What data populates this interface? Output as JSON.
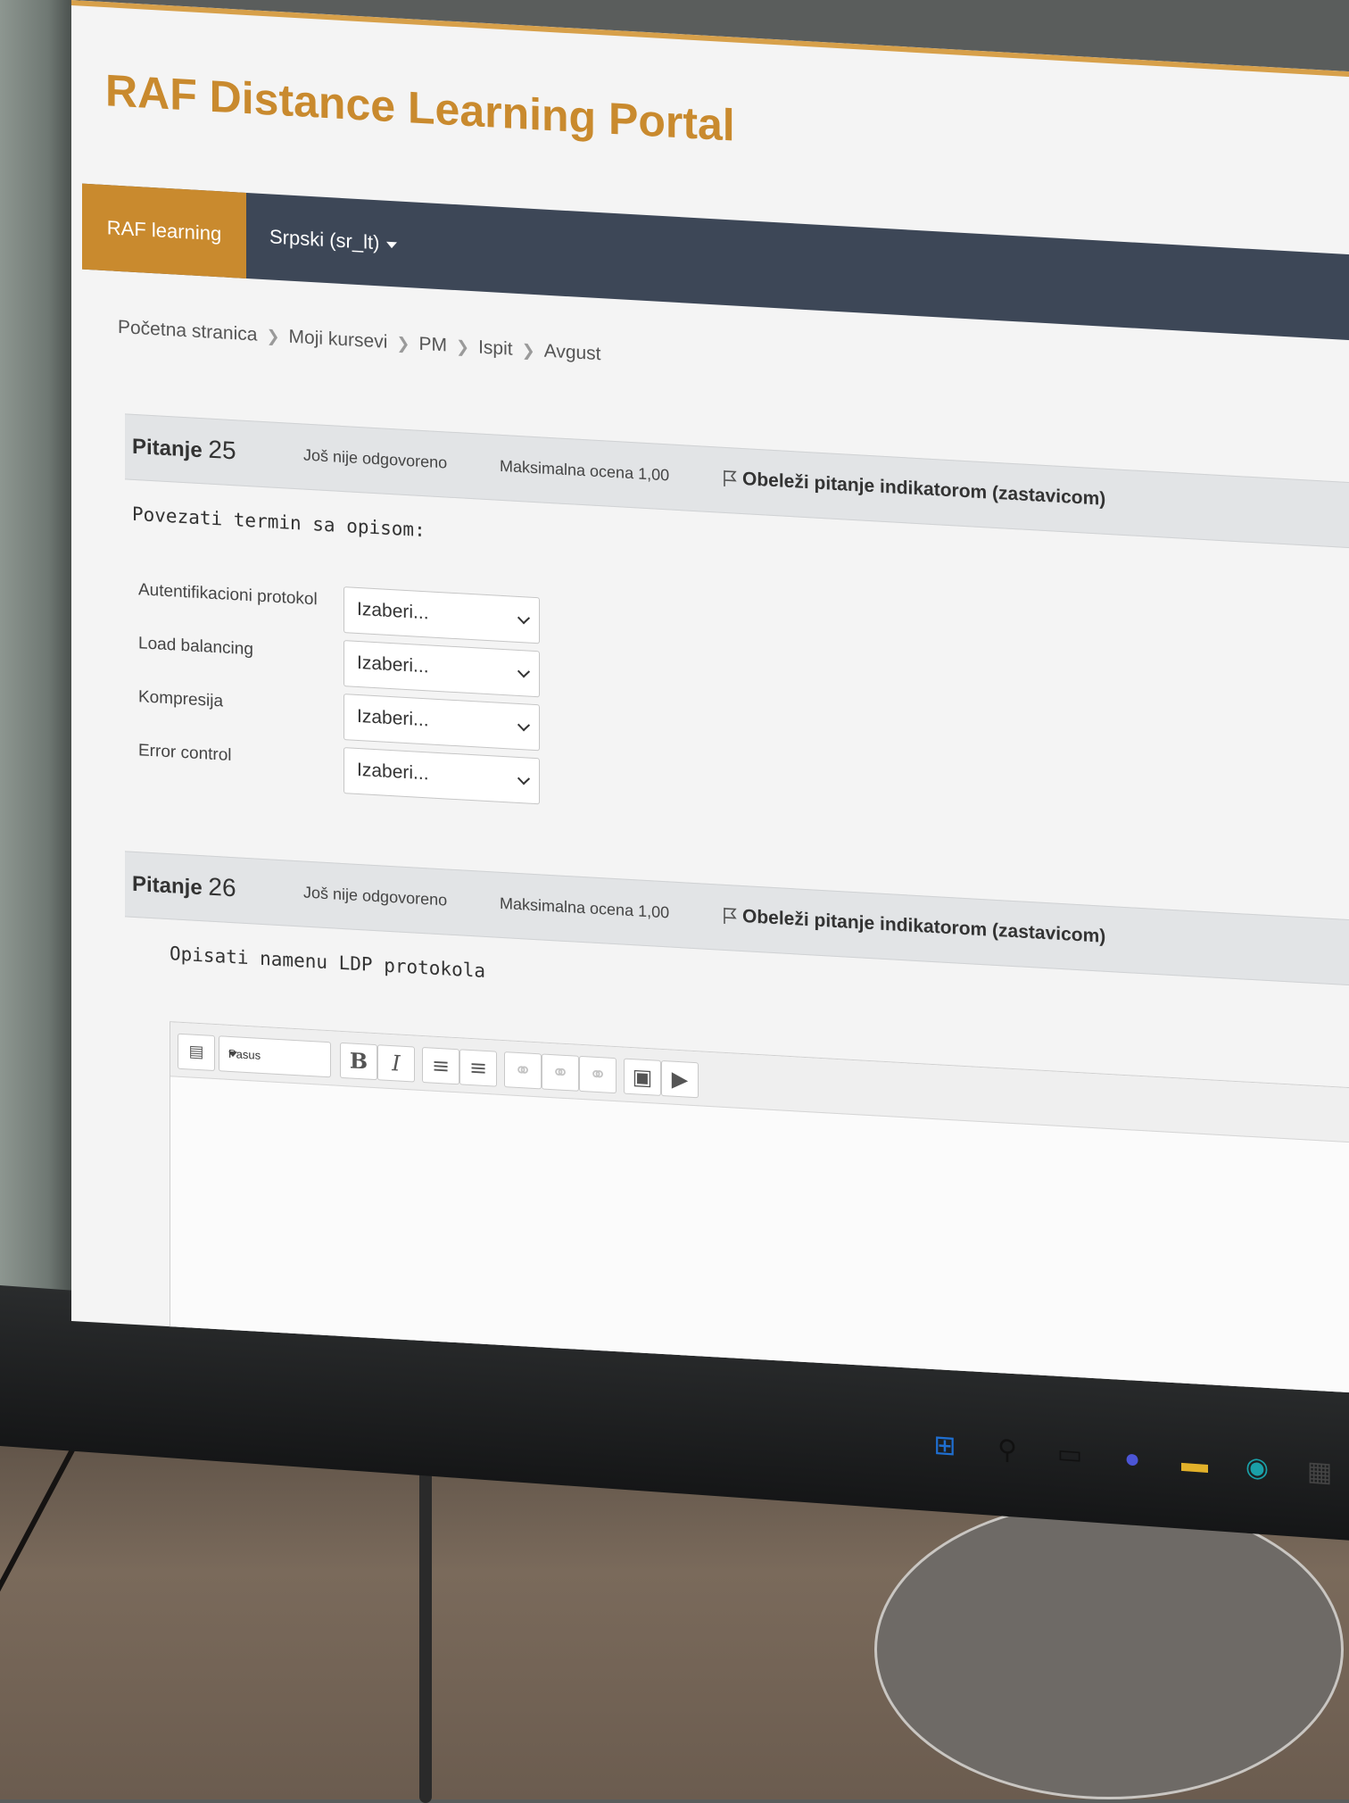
{
  "site": {
    "title": "RAF Distance Learning Portal"
  },
  "nav": {
    "home": "RAF learning",
    "language": "Srpski (sr_lt)"
  },
  "breadcrumb": [
    "Početna stranica",
    "Moji kursevi",
    "PM",
    "Ispit",
    "Avgust"
  ],
  "q25": {
    "label": "Pitanje",
    "number": "25",
    "status": "Još nije odgovoreno",
    "grade": "Maksimalna ocena 1,00",
    "flag": "Obeleži pitanje indikatorom (zastavicom)",
    "text": "Povezati termin sa opisom:",
    "rows": [
      {
        "label": "Autentifikacioni protokol",
        "value": "Izaberi..."
      },
      {
        "label": "Load balancing",
        "value": "Izaberi..."
      },
      {
        "label": "Kompresija",
        "value": "Izaberi..."
      },
      {
        "label": "Error control",
        "value": "Izaberi..."
      }
    ]
  },
  "q26": {
    "label": "Pitanje",
    "number": "26",
    "status": "Još nije odgovoreno",
    "grade": "Maksimalna ocena 1,00",
    "flag": "Obeleži pitanje indikatorom (zastavicom)",
    "text": "Opisati namenu LDP protokola"
  },
  "editor": {
    "paragraph_select": "Pasus",
    "bold": "B",
    "italic": "I",
    "unordered_list_icon": "≡",
    "ordered_list_icon": "≡",
    "link_icon": "⚭",
    "unlink_icon": "⚭",
    "anchor_icon": "⚭",
    "image_icon": "▣",
    "media_icon": "▶",
    "show_more_icon": "▤"
  },
  "taskbar": {
    "icons": [
      "windows-icon",
      "search-icon",
      "task-view-icon",
      "chat-icon",
      "file-explorer-icon",
      "edge-icon",
      "store-icon"
    ],
    "glyphs": [
      "⊞",
      "⚲",
      "▭",
      "●",
      "▬",
      "◉",
      "▦"
    ]
  },
  "colors": {
    "accent": "#c98a2e",
    "navbar": "#3d4757"
  }
}
